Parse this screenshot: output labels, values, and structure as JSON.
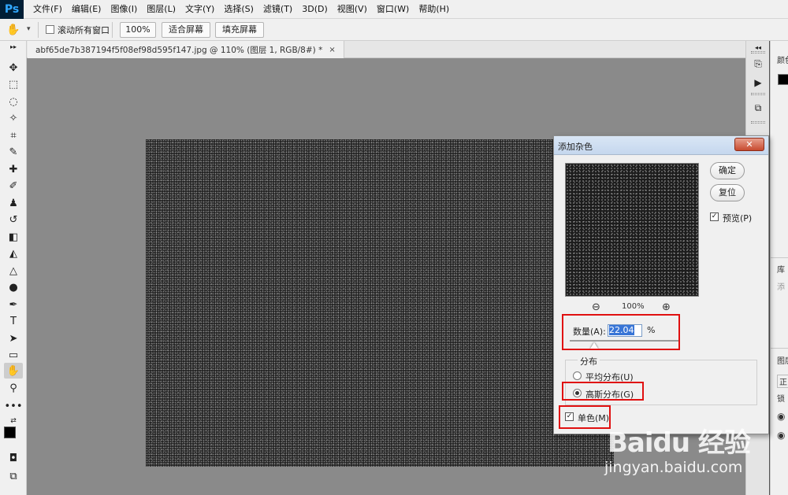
{
  "app": {
    "logo": "Ps"
  },
  "menu": [
    "文件(F)",
    "编辑(E)",
    "图像(I)",
    "图层(L)",
    "文字(Y)",
    "选择(S)",
    "滤镜(T)",
    "3D(D)",
    "视图(V)",
    "窗口(W)",
    "帮助(H)"
  ],
  "options_bar": {
    "scroll_all_label": "滚动所有窗口",
    "zoom_value": "100%",
    "fit_screen_label": "适合屏幕",
    "fill_screen_label": "填充屏幕"
  },
  "document_tab": {
    "title": "abf65de7b387194f5f08ef98d595f147.jpg @ 110% (图层 1, RGB/8#) *",
    "close": "×"
  },
  "right_panel": {
    "color_label": "颜色",
    "library_label": "库",
    "library_add": "添",
    "layers_label": "图层",
    "layers_mode": "正",
    "layers_lock": "锁"
  },
  "dialog": {
    "title": "添加杂色",
    "ok_label": "确定",
    "reset_label": "复位",
    "preview_label": "预览(P)",
    "preview_checked": true,
    "zoom_level": "100%",
    "amount_label": "数量(A):",
    "amount_value": "22.04",
    "amount_unit": "%",
    "amount_slider_fraction": 0.22,
    "distribution_label": "分布",
    "uniform_label": "平均分布(U)",
    "gaussian_label": "高斯分布(G)",
    "selected_distribution": "gaussian",
    "monochromatic_label": "单色(M)",
    "monochromatic_checked": true
  },
  "watermark": {
    "brand": "Baidu 经验",
    "url": "jingyan.baidu.com"
  },
  "colors": {
    "highlight": "#e01010",
    "canvas_bg": "#8a8a8a"
  }
}
